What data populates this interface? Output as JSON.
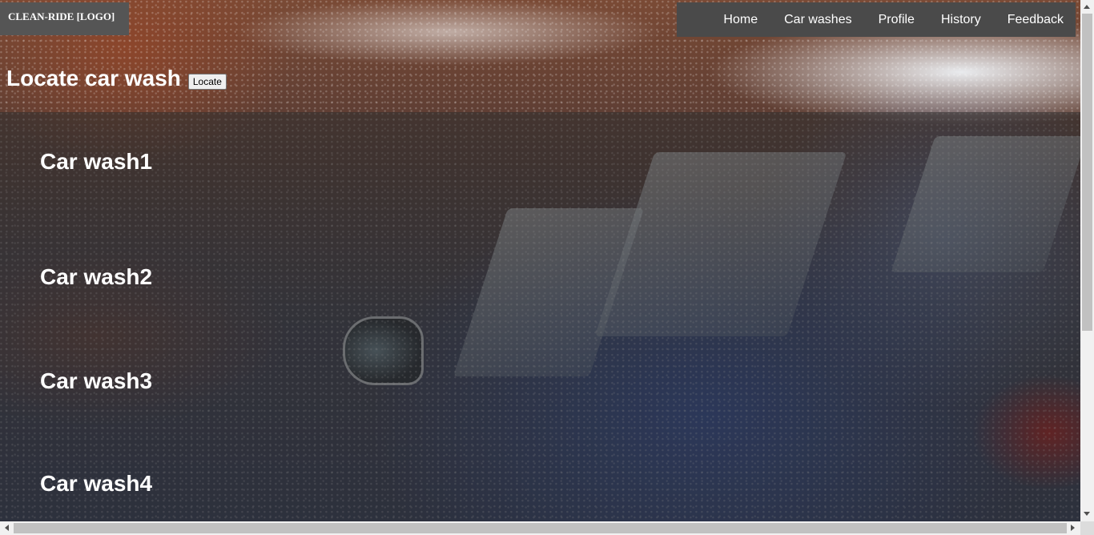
{
  "header": {
    "logo": "CLEAN-RIDE [LOGO]",
    "nav": [
      "Home",
      "Car washes",
      "Profile",
      "History",
      "Feedback"
    ]
  },
  "locate": {
    "title": "Locate car wash",
    "button": "Locate"
  },
  "car_washes": [
    "Car wash1",
    "Car wash2",
    "Car wash3",
    "Car wash4"
  ],
  "colors": {
    "logo_bg": "#555555",
    "nav_bg": "#4a4a4a",
    "text": "#ffffff"
  }
}
